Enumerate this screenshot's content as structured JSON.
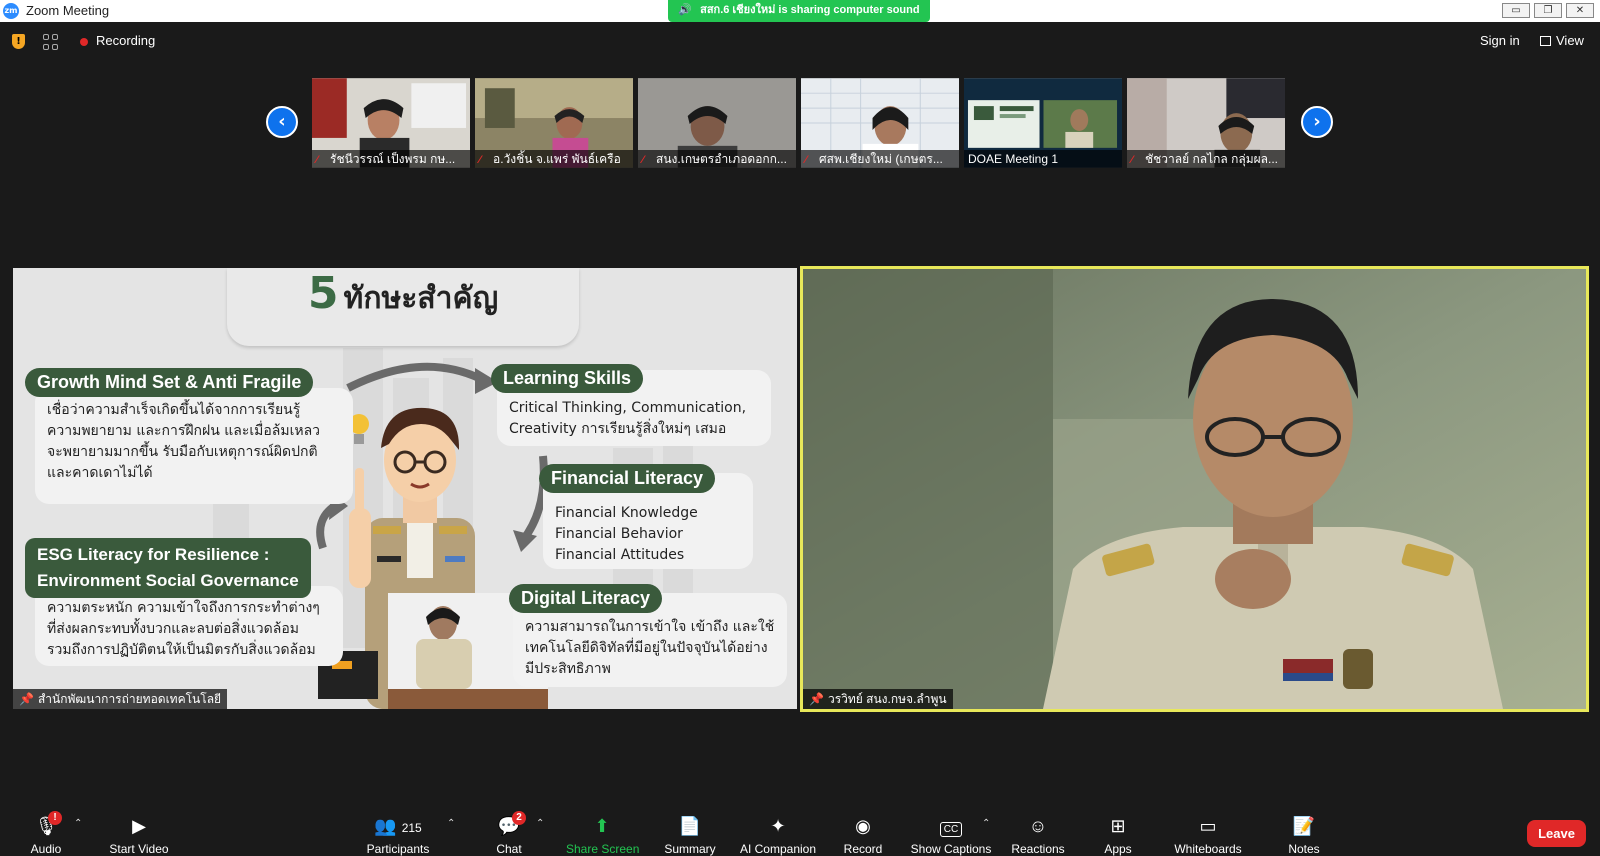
{
  "window": {
    "title": "Zoom Meeting",
    "share_banner": "สสก.6 เชียงใหม่ is sharing computer sound",
    "controls": {
      "minimize": "▭",
      "restore": "❐",
      "close": "✕"
    }
  },
  "topbar": {
    "recording_label": "Recording",
    "signin_label": "Sign in",
    "view_label": "View"
  },
  "thumbnails": [
    {
      "name": "รัชนีวรรณ์ เป็งพรม กษ...",
      "muted": true
    },
    {
      "name": "อ.วังชิ้น จ.แพร่ พันธ์เครือ",
      "muted": true
    },
    {
      "name": "สนง.เกษตรอำเภอดอกก...",
      "muted": true
    },
    {
      "name": "ศสพ.เชียงใหม่ (เกษตร...",
      "muted": true
    },
    {
      "name": "DOAE Meeting 1",
      "muted": false
    },
    {
      "name": "ชัชวาลย์ กลไกล กลุ่มผล...",
      "muted": true
    }
  ],
  "share_tile": {
    "owner_name": "สำนักพัฒนาการถ่ายทอดเทคโนโลยี",
    "slide": {
      "title_number": "5",
      "title_text": "ทักษะสำคัญ",
      "sections": {
        "growth": {
          "heading": "Growth Mind Set & Anti Fragile",
          "lines": [
            "เชื่อว่าความสำเร็จเกิดขึ้นได้จากการเรียนรู้",
            "ความพยายาม และการฝึกฝน และเมื่อล้มเหลว",
            "จะพยายามมากขึ้น รับมือกับเหตุการณ์ผิดปกติ",
            "และคาดเดาไม่ได้"
          ]
        },
        "learning": {
          "heading": "Learning Skills",
          "lines": [
            "Critical Thinking, Communication,",
            "Creativity การเรียนรู้สิ่งใหม่ๆ เสมอ"
          ]
        },
        "financial": {
          "heading": "Financial Literacy",
          "lines": [
            "Financial Knowledge",
            "Financial Behavior",
            "Financial Attitudes"
          ]
        },
        "esg": {
          "heading_line1": "ESG Literacy for Resilience :",
          "heading_line2": "Environment Social Governance",
          "lines": [
            "ความตระหนัก ความเข้าใจถึงการกระทำต่างๆ",
            "ที่ส่งผลกระทบทั้งบวกและลบต่อสิ่งแวดล้อม",
            "รวมถึงการปฏิบัติตนให้เป็นมิตรกับสิ่งแวดล้อม"
          ]
        },
        "digital": {
          "heading": "Digital Literacy",
          "lines": [
            "ความสามารถในการเข้าใจ เข้าถึง และใช้",
            "เทคโนโลยีดิจิทัลที่มีอยู่ในปัจจุบันได้อย่าง",
            "มีประสิทธิภาพ"
          ]
        }
      }
    }
  },
  "video_tile": {
    "name": "วรวิทย์ สนง.กษจ.ลำพูน"
  },
  "toolbar": {
    "audio": {
      "label": "Audio",
      "badge": "!"
    },
    "video": {
      "label": "Start Video"
    },
    "participants": {
      "label": "Participants",
      "count": "215"
    },
    "chat": {
      "label": "Chat",
      "badge": "2"
    },
    "share": {
      "label": "Share Screen"
    },
    "summary": {
      "label": "Summary"
    },
    "ai": {
      "label": "AI Companion"
    },
    "record": {
      "label": "Record"
    },
    "captions": {
      "label": "Show Captions",
      "icon_text": "CC"
    },
    "reactions": {
      "label": "Reactions"
    },
    "apps": {
      "label": "Apps"
    },
    "whiteboards": {
      "label": "Whiteboards"
    },
    "notes": {
      "label": "Notes"
    },
    "leave": {
      "label": "Leave"
    }
  },
  "colors": {
    "accent": "#0e72ed",
    "share_green": "#23c552",
    "leave_red": "#e02828",
    "active_speaker_border": "#e8e85a",
    "slide_green": "#3a5a3c"
  }
}
